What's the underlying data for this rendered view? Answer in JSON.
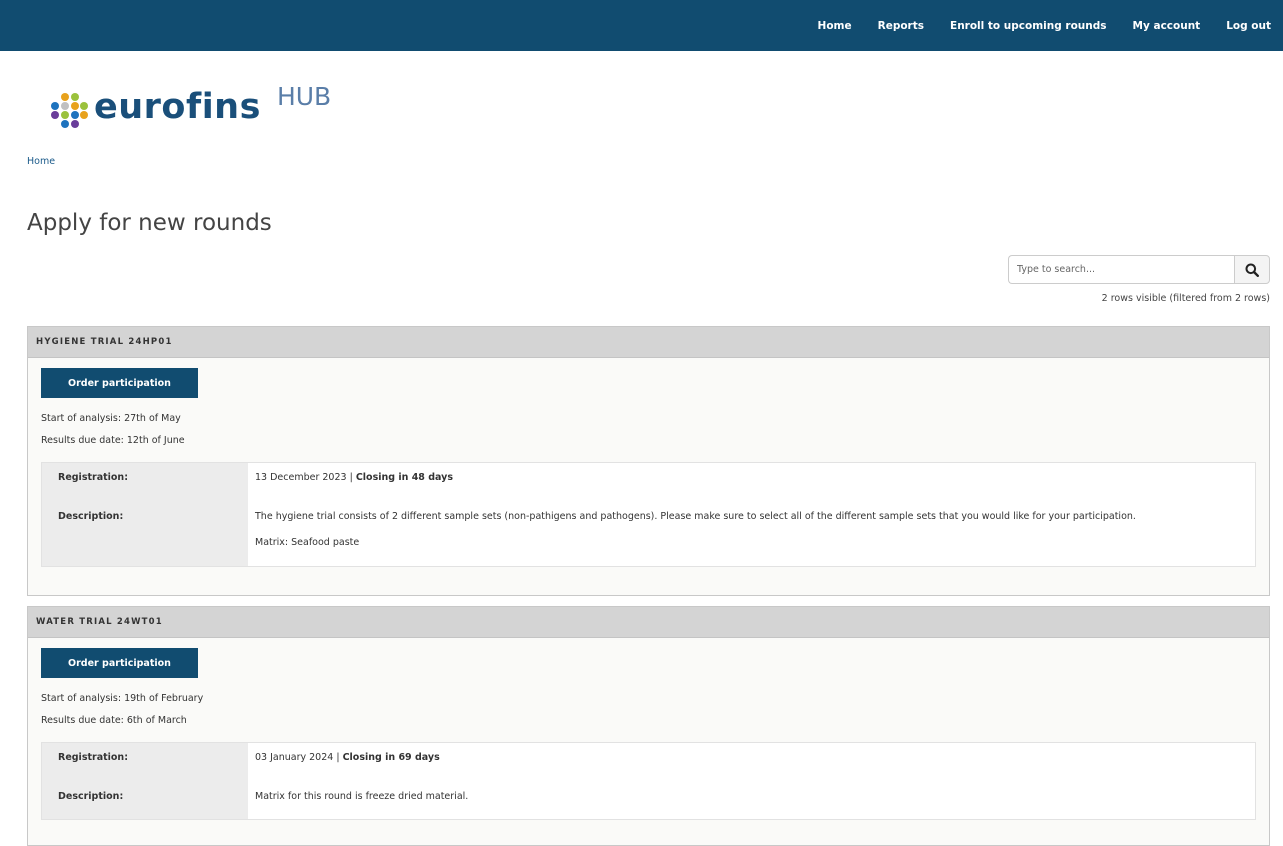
{
  "nav": {
    "items": [
      "Home",
      "Reports",
      "Enroll to upcoming rounds",
      "My account",
      "Log out"
    ]
  },
  "logo": {
    "word": "eurofins",
    "suffix": "HUB"
  },
  "breadcrumb": "Home",
  "page_title": "Apply for new rounds",
  "search": {
    "placeholder": "Type to search...",
    "rows_visible": "2 rows visible (filtered from 2 rows)"
  },
  "trials": [
    {
      "title": "HYGIENE TRIAL 24HP01",
      "order_label": "Order participation",
      "start": "Start of analysis: 27th of May",
      "due": "Results due date: 12th of June",
      "registration_label": "Registration:",
      "registration_date": "13 December 2023",
      "registration_sep": " | ",
      "registration_closing": "Closing in 48 days",
      "description_label": "Description:",
      "description": "The hygiene trial consists of 2 different sample sets (non-pathigens and pathogens). Please make sure to select all of the different sample sets that you would like for your participation.",
      "matrix": "Matrix: Seafood paste"
    },
    {
      "title": "WATER TRIAL 24WT01",
      "order_label": "Order participation",
      "start": "Start of analysis: 19th of February",
      "due": "Results due date: 6th of March",
      "registration_label": "Registration:",
      "registration_date": "03 January 2024",
      "registration_sep": " | ",
      "registration_closing": "Closing in 69 days",
      "description_label": "Description:",
      "description": "Matrix for this round is freeze dried material."
    }
  ],
  "colors": {
    "nav_bg": "#114c70",
    "button_bg": "#114c70",
    "header_bg": "#d4d4d4"
  },
  "icons": {
    "search": "magnifier-icon"
  }
}
